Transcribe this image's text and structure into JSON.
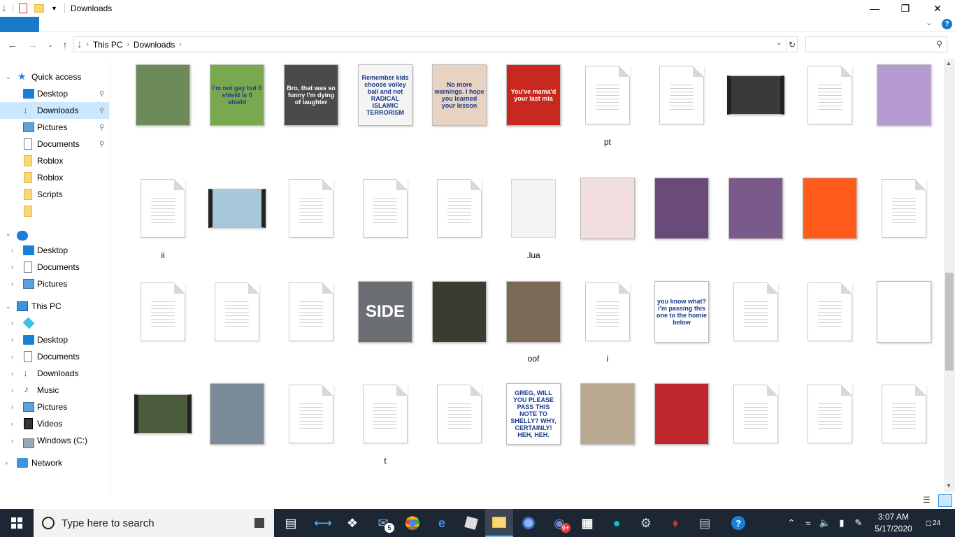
{
  "window": {
    "title": "Downloads"
  },
  "address": {
    "crumbs": [
      "This PC",
      "Downloads"
    ]
  },
  "search": {
    "placeholder": ""
  },
  "help_glyph": "?",
  "sidebar": {
    "quick_access": "Quick access",
    "quick_items": [
      {
        "label": "Desktop",
        "icon": "desktop-icon",
        "pinned": true
      },
      {
        "label": "Downloads",
        "icon": "downloads-icon",
        "pinned": true,
        "selected": true
      },
      {
        "label": "Pictures",
        "icon": "pictures-icon",
        "pinned": true
      },
      {
        "label": "Documents",
        "icon": "documents-icon",
        "pinned": true
      },
      {
        "label": "Roblox",
        "icon": "folder-icon"
      },
      {
        "label": "Roblox",
        "icon": "folder-icon"
      },
      {
        "label": "Scripts",
        "icon": "folder-icon"
      },
      {
        "label": "",
        "icon": "folder-icon"
      }
    ],
    "onedrive_label": "",
    "onedrive_items": [
      "Desktop",
      "Documents",
      "Pictures"
    ],
    "this_pc": "This PC",
    "this_pc_items": [
      "",
      "Desktop",
      "Documents",
      "Downloads",
      "Music",
      "Pictures",
      "Videos",
      "Windows (C:)"
    ],
    "network": "Network"
  },
  "files": [
    {
      "kind": "image",
      "caption": "",
      "bg": "#6d8a5a",
      "text": ""
    },
    {
      "kind": "image",
      "caption": "",
      "bg": "#7aa84f",
      "text": "I'm not gay but 0 shield is 0 shield"
    },
    {
      "kind": "image",
      "caption": "",
      "bg": "#4a4a4a",
      "text": "Bro, that was so funny  I'm dying of laughter"
    },
    {
      "kind": "image",
      "caption": "",
      "bg": "#f4f4f4",
      "text": "Remember kids choose volley ball and not RADICAL ISLAMIC TERRORISM"
    },
    {
      "kind": "image",
      "caption": "",
      "bg": "#e8d3c2",
      "text": "No more warnings. I hope you learned your lesson"
    },
    {
      "kind": "image",
      "caption": "",
      "bg": "#c8281e",
      "text": "You've mama'd your last mia"
    },
    {
      "kind": "doc",
      "caption": "pt"
    },
    {
      "kind": "doc",
      "caption": ""
    },
    {
      "kind": "video",
      "caption": "",
      "bg": "#3a3a3a"
    },
    {
      "kind": "doc",
      "caption": ""
    },
    {
      "kind": "image",
      "caption": "",
      "bg": "#b59ad2",
      "text": ""
    },
    {
      "kind": "doc",
      "caption": "ii"
    },
    {
      "kind": "video",
      "caption": "",
      "bg": "#a6c8d8"
    },
    {
      "kind": "doc",
      "caption": ""
    },
    {
      "kind": "doc",
      "caption": ""
    },
    {
      "kind": "doc",
      "caption": ""
    },
    {
      "kind": "blank",
      "caption": ".lua"
    },
    {
      "kind": "image",
      "caption": "",
      "bg": "#f2dede",
      "text": ""
    },
    {
      "kind": "image",
      "caption": "",
      "bg": "#6a4a78",
      "text": ""
    },
    {
      "kind": "image",
      "caption": "",
      "bg": "#7a5a8a",
      "text": ""
    },
    {
      "kind": "image",
      "caption": "",
      "bg": "#ff5a1a",
      "text": ""
    },
    {
      "kind": "doc",
      "caption": ""
    },
    {
      "kind": "doc",
      "caption": ""
    },
    {
      "kind": "doc",
      "caption": ""
    },
    {
      "kind": "doc",
      "caption": ""
    },
    {
      "kind": "image",
      "caption": "",
      "bg": "#6b6f73",
      "text": "SIDE"
    },
    {
      "kind": "image",
      "caption": "",
      "bg": "#3b3b30",
      "text": ""
    },
    {
      "kind": "image",
      "caption": "oof",
      "bg": "#7a6a55",
      "text": ""
    },
    {
      "kind": "doc",
      "caption": "i"
    },
    {
      "kind": "image",
      "caption": "",
      "bg": "#ffffff",
      "text": "you know what? i'm passing this one to the homie below"
    },
    {
      "kind": "doc",
      "caption": ""
    },
    {
      "kind": "doc",
      "caption": ""
    },
    {
      "kind": "image",
      "caption": "",
      "bg": "#ffffff",
      "text": ""
    },
    {
      "kind": "video",
      "caption": "",
      "bg": "#4a5a3a"
    },
    {
      "kind": "image",
      "caption": "",
      "bg": "#7a8a98",
      "text": ""
    },
    {
      "kind": "doc",
      "caption": ""
    },
    {
      "kind": "doc",
      "caption": "t"
    },
    {
      "kind": "doc",
      "caption": ""
    },
    {
      "kind": "image",
      "caption": "",
      "bg": "#ffffff",
      "text": "GREG, WILL YOU PLEASE PASS THIS NOTE TO SHELLY? WHY, CERTAINLY! HEH, HEH."
    },
    {
      "kind": "image",
      "caption": "",
      "bg": "#b9a892",
      "text": ""
    },
    {
      "kind": "image",
      "caption": "",
      "bg": "#c0272d",
      "text": ""
    },
    {
      "kind": "doc",
      "caption": ""
    },
    {
      "kind": "doc",
      "caption": ""
    },
    {
      "kind": "doc",
      "caption": ""
    }
  ],
  "taskbar": {
    "search_placeholder": "Type here to search",
    "mail_badge": "5",
    "discord_badge": "9+",
    "time": "3:07 AM",
    "date": "5/17/2020",
    "notifications": "24"
  }
}
